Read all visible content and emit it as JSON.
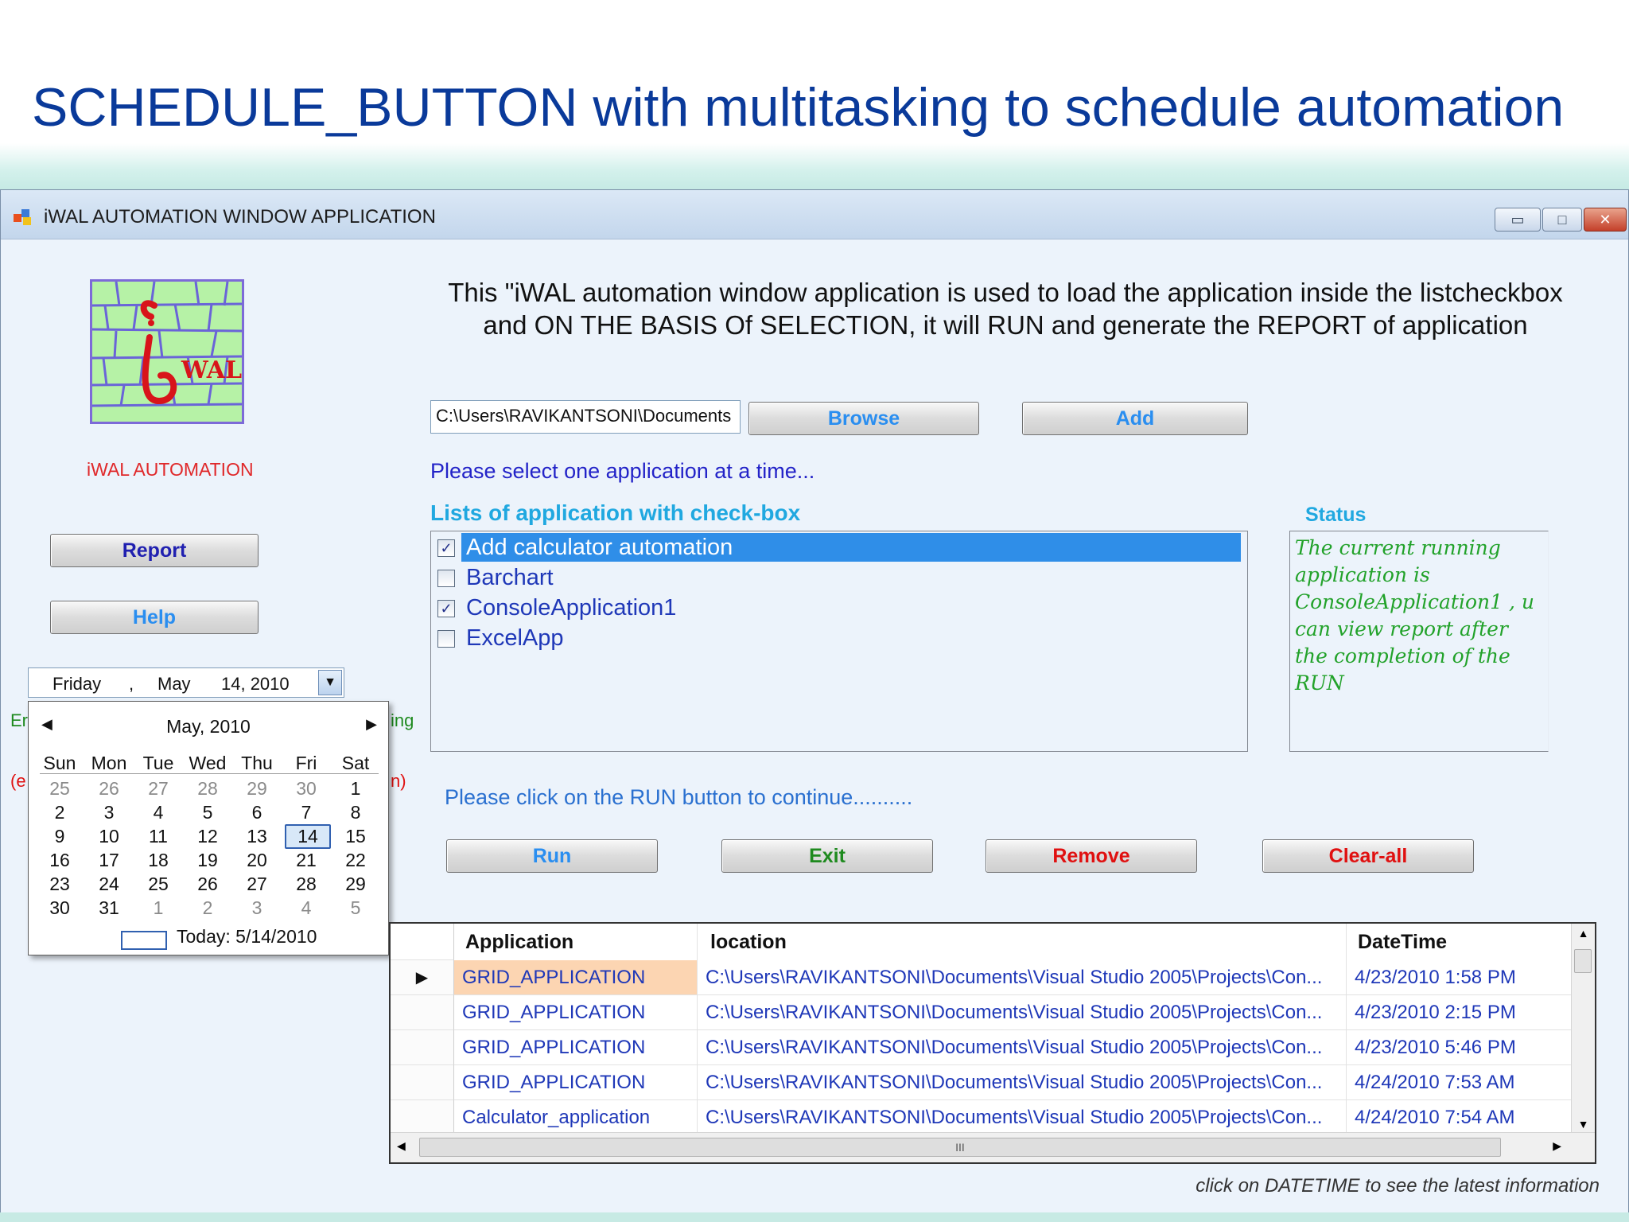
{
  "slide": {
    "title": "SCHEDULE_BUTTON  with multitasking to schedule automation"
  },
  "window": {
    "title": "iWAL AUTOMATION WINDOW APPLICATION",
    "min_glyph": "▭",
    "max_glyph": "□",
    "close_glyph": "✕"
  },
  "logo": {
    "word": "WAL",
    "caption": "iWAL AUTOMATION"
  },
  "intro": {
    "line1": "This \"iWAL automation window application is used to load the application inside the listcheckbox",
    "line2": "and ON THE BASIS Of SELECTION, it will RUN and generate the REPORT of application"
  },
  "file": {
    "path_value": "C:\\Users\\RAVIKANTSONI\\Documents",
    "browse_label": "Browse",
    "add_label": "Add"
  },
  "hints": {
    "select_one": "Please select one application at a time...",
    "click_run": "Please click on the RUN button to continue.........."
  },
  "list": {
    "label": "Lists of application with check-box",
    "items": [
      {
        "label": "Add  calculator  automation",
        "checked": true,
        "selected": true
      },
      {
        "label": "Barchart",
        "checked": false,
        "selected": false
      },
      {
        "label": "ConsoleApplication1",
        "checked": true,
        "selected": false
      },
      {
        "label": "ExcelApp",
        "checked": false,
        "selected": false
      }
    ]
  },
  "status": {
    "label": "Status",
    "text": "The current running application is ConsoleApplication1  , u can view report after the completion of the RUN"
  },
  "sidebar": {
    "report_label": "Report",
    "help_label": "Help"
  },
  "datepicker": {
    "day": "Friday",
    "sep": ",",
    "month": "May",
    "date": "14, 2010",
    "dropdown_glyph": "▼"
  },
  "calendar": {
    "header": "May, 2010",
    "prev_glyph": "◀",
    "next_glyph": "▶",
    "days_of_week": [
      "Sun",
      "Mon",
      "Tue",
      "Wed",
      "Thu",
      "Fri",
      "Sat"
    ],
    "weeks": [
      [
        "25",
        "26",
        "27",
        "28",
        "29",
        "30",
        "1"
      ],
      [
        "2",
        "3",
        "4",
        "5",
        "6",
        "7",
        "8"
      ],
      [
        "9",
        "10",
        "11",
        "12",
        "13",
        "14",
        "15"
      ],
      [
        "16",
        "17",
        "18",
        "19",
        "20",
        "21",
        "22"
      ],
      [
        "23",
        "24",
        "25",
        "26",
        "27",
        "28",
        "29"
      ],
      [
        "30",
        "31",
        "1",
        "2",
        "3",
        "4",
        "5"
      ]
    ],
    "selected_day": "14",
    "today_label": "Today: 5/14/2010"
  },
  "fragments": {
    "left_e1": "Er",
    "left_e2": "(e",
    "right_ing": "ing",
    "right_paren": "n)"
  },
  "actions": {
    "run_label": "Run",
    "exit_label": "Exit",
    "remove_label": "Remove",
    "clear_label": "Clear-all"
  },
  "grid": {
    "columns": [
      "Application",
      "location",
      "DateTime"
    ],
    "rows": [
      [
        "GRID_APPLICATION",
        "C:\\Users\\RAVIKANTSONI\\Documents\\Visual Studio 2005\\Projects\\Con...",
        "4/23/2010 1:58 PM"
      ],
      [
        "GRID_APPLICATION",
        "C:\\Users\\RAVIKANTSONI\\Documents\\Visual Studio 2005\\Projects\\Con...",
        "4/23/2010 2:15 PM"
      ],
      [
        "GRID_APPLICATION",
        "C:\\Users\\RAVIKANTSONI\\Documents\\Visual Studio 2005\\Projects\\Con...",
        "4/23/2010 5:46 PM"
      ],
      [
        "GRID_APPLICATION",
        "C:\\Users\\RAVIKANTSONI\\Documents\\Visual Studio 2005\\Projects\\Con...",
        "4/24/2010 7:53 AM"
      ],
      [
        "Calculator_application",
        "C:\\Users\\RAVIKANTSONI\\Documents\\Visual Studio 2005\\Projects\\Con...",
        "4/24/2010 7:54 AM"
      ]
    ],
    "current_row_glyph": "▶",
    "scroll_up": "▲",
    "scroll_down": "▼",
    "scroll_left": "◀",
    "scroll_right": "▶",
    "scroll_grip": "III"
  },
  "footer": {
    "note": "click on DATETIME to see the latest information"
  },
  "colors": {
    "title_blue": "#0a3a9a",
    "button_blue": "#2a8ef0",
    "button_green": "#1e8a1e",
    "button_red": "#e01010",
    "selection_blue": "#2f8ee8"
  }
}
